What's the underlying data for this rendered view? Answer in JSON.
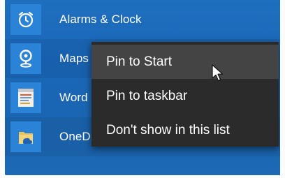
{
  "apps": [
    {
      "label": "Alarms & Clock",
      "icon": "alarm-clock-icon"
    },
    {
      "label": "Maps",
      "icon": "maps-icon"
    },
    {
      "label": "Word",
      "icon": "word-document-icon"
    },
    {
      "label": "OneDrive",
      "icon": "onedrive-folder-icon"
    }
  ],
  "context_menu": {
    "items": [
      {
        "label": "Pin to Start",
        "highlighted": true
      },
      {
        "label": "Pin to taskbar",
        "highlighted": false
      },
      {
        "label": "Don't show in this list",
        "highlighted": false
      }
    ]
  },
  "colors": {
    "start_bg": "#1b66b2",
    "tile_bg": "#2a83d6",
    "menu_bg": "#2b2b2b",
    "menu_hover": "#444444"
  }
}
